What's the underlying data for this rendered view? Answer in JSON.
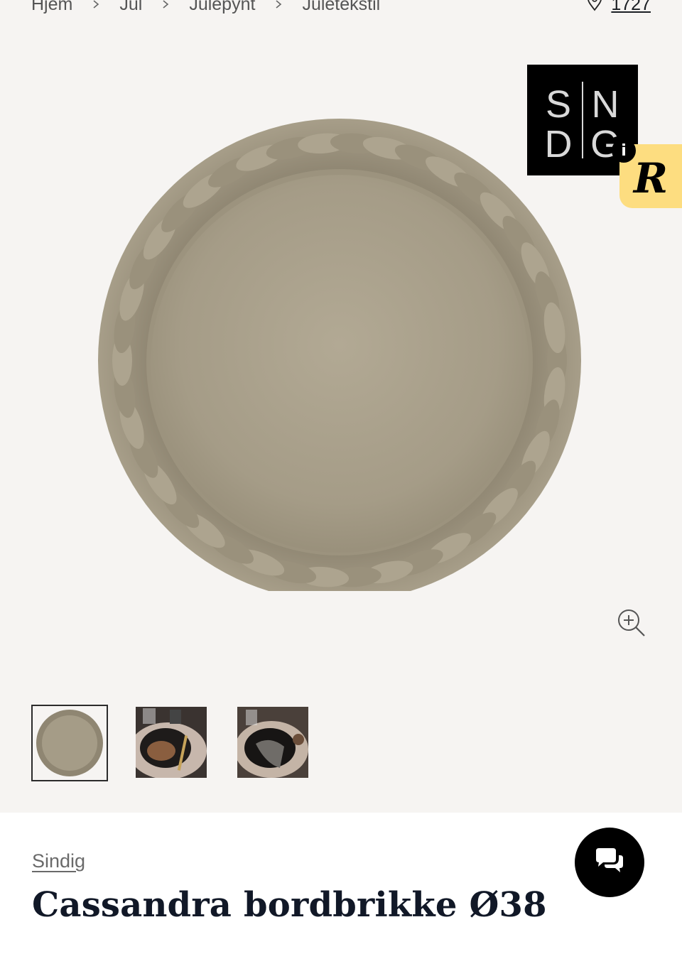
{
  "breadcrumb": {
    "items": [
      "Hjem",
      "Jul",
      "Julepynt",
      "Juletekstil"
    ]
  },
  "store": {
    "count": "1727",
    "icon": "location-pin-icon"
  },
  "brand_logo": {
    "line1_left": "S",
    "line1_right": "N",
    "line2_left": "D",
    "line2_right": "G",
    "dot_letter": "i"
  },
  "badge": {
    "letter": "R",
    "color": "#fddd80"
  },
  "gallery": {
    "active_index": 0,
    "thumbnails": [
      "placemat-flatlay",
      "table-setting-1",
      "table-setting-2"
    ]
  },
  "product": {
    "brand": "Sindig",
    "title": "Cassandra bordbrikke Ø38"
  },
  "colors": {
    "background": "#f6f4f2",
    "fabric": "#a39a86",
    "accent": "#fddd80",
    "text": "#1b1f24"
  }
}
